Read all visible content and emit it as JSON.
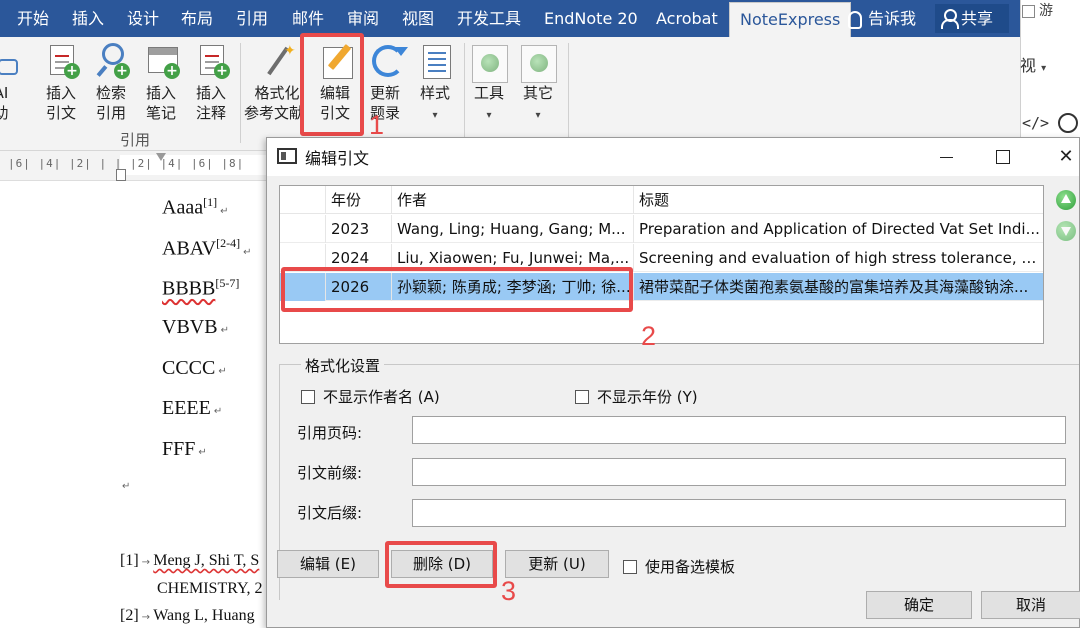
{
  "ribbon": {
    "tabs": [
      "开始",
      "插入",
      "设计",
      "布局",
      "引用",
      "邮件",
      "审阅",
      "视图",
      "开发工具",
      "EndNote 20",
      "Acrobat",
      "NoteExpress"
    ],
    "active_tab": "NoteExpress",
    "tell_me": "告诉我",
    "share": "共享",
    "buttons": {
      "ai_assist": {
        "line1": "AI",
        "line2": "助"
      },
      "insert_citation": {
        "line1": "插入",
        "line2": "引文"
      },
      "search_citation": {
        "line1": "检索",
        "line2": "引用"
      },
      "insert_note": {
        "line1": "插入",
        "line2": "笔记"
      },
      "insert_annotation": {
        "line1": "插入",
        "line2": "注释"
      },
      "format_bibliography": {
        "line1": "格式化",
        "line2": "参考文献"
      },
      "edit_citation": {
        "line1": "编辑",
        "line2": "引文"
      },
      "update_bibliography": {
        "line1": "更新",
        "line2": "题录"
      },
      "style": {
        "line1": "样式"
      },
      "tools": {
        "line1": "工具"
      },
      "other": {
        "line1": "其它"
      }
    },
    "group_label": "引用"
  },
  "right_window": {
    "top_text": "游",
    "view_text": "视",
    "code_text": "</>"
  },
  "ruler_text": "|6| |4| |2| | | |2| |4| |6| |8|",
  "document": {
    "lines": [
      {
        "text": "Aaaa",
        "sup": "[1]"
      },
      {
        "text": "ABAV",
        "sup": "[2-4]"
      },
      {
        "text": "BBBB",
        "sup": "[5-7]"
      },
      {
        "text": "VBVB",
        "sup": ""
      },
      {
        "text": "CCCC",
        "sup": ""
      },
      {
        "text": "EEEE",
        "sup": ""
      },
      {
        "text": "FFF",
        "sup": ""
      }
    ],
    "references": [
      {
        "num": "[1]",
        "line1": "Meng J, Shi T, S",
        "line2": "CHEMISTRY, 2"
      },
      {
        "num": "[2]",
        "line1": "Wang L, Huang",
        "line2": ""
      }
    ]
  },
  "dialog": {
    "title": "编辑引文",
    "close_glyph": "✕",
    "columns": [
      "年份",
      "作者",
      "标题"
    ],
    "rows": [
      {
        "year": "2023",
        "authors": "Wang, Ling; Huang, Gang; M...",
        "title": "Preparation and Application of Directed Vat Set Indi..."
      },
      {
        "year": "2024",
        "authors": "Liu, Xiaowen; Fu, Junwei; Ma,...",
        "title": "Screening and evaluation of high stress tolerance, hi..."
      },
      {
        "year": "2026",
        "authors": "孙颖颖; 陈勇成; 李梦涵; 丁帅; 徐...",
        "title": "裙带菜配子体类菌孢素氨基酸的富集培养及其海藻酸钠涂..."
      }
    ],
    "selected_row": 2,
    "format_settings": {
      "legend": "格式化设置",
      "hide_author": "不显示作者名 (A)",
      "hide_year": "不显示年份 (Y)",
      "page_label": "引用页码:",
      "prefix_label": "引文前缀:",
      "suffix_label": "引文后缀:",
      "page_value": "",
      "prefix_value": "",
      "suffix_value": ""
    },
    "buttons": {
      "edit": "编辑 (E)",
      "delete": "删除 (D)",
      "update": "更新 (U)",
      "use_alt_template": "使用备选模板",
      "ok": "确定",
      "cancel": "取消"
    }
  },
  "annotations": {
    "step1": "1",
    "step2": "2",
    "step3": "3"
  },
  "colors": {
    "ribbon_blue": "#2b579a",
    "selection_blue": "#99c9f4",
    "annotation_red": "#e84a4a"
  }
}
